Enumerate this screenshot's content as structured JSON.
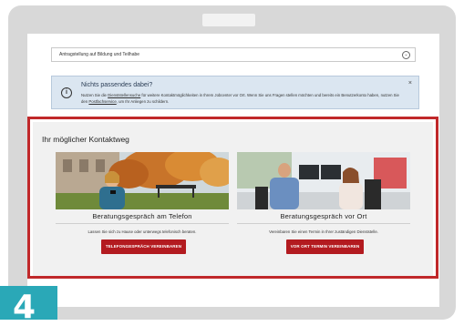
{
  "dropdown": {
    "value": "Antragstellung auf Bildung und Teilhabe"
  },
  "info_box": {
    "title": "Nichts passendes dabei?",
    "text_part1": "Nutzen Sie die ",
    "link1": "Dienststellensuche",
    "text_part2": " für weitere Kontaktmöglichkeiten in Ihrem Jobcenter vor Ort. Wenn Sie uns Fragen stellen möchten und bereits ein Benutzerkonto haben, nutzen Sie den ",
    "link2": "Postfachservice",
    "text_part3": ", um Ihr Anliegen zu schildern.",
    "close": "×"
  },
  "section": {
    "heading": "Ihr möglicher Kontaktweg",
    "cards": [
      {
        "title": "Beratungsgespräch am Telefon",
        "text": "Lassen Sie sich zu Hause oder unterwegs telefonisch beraten.",
        "button": "TELEFONGESPRÄCH VEREINBAREN"
      },
      {
        "title": "Beratungsgespräch vor Ort",
        "text": "Vereinbaren Sie einen Termin in Ihrer zuständigen Dienststelle.",
        "button": "VOR ORT TERMIN VEREINBAREN"
      }
    ]
  },
  "step_badge": {
    "number": "4"
  },
  "colors": {
    "accent_red": "#b31b20",
    "frame_red": "#c0282a",
    "info_bg": "#dbe6f1",
    "badge_teal": "#2aa8b7"
  },
  "icons": {
    "info": "info-circle-icon",
    "dropdown": "chevron-down-icon",
    "close": "close-icon"
  }
}
